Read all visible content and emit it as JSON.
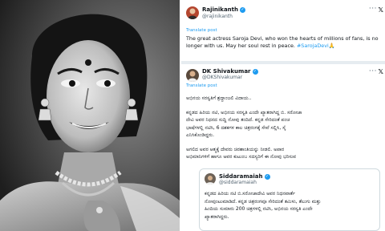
{
  "tweets": [
    {
      "name": "Rajinikanth",
      "handle": "@rajinikanth",
      "translate": "Translate post",
      "text_main": "The great actress Saroja Devi, who won the hearts of millions of fans, is no longer with us. May her soul rest in peace. ",
      "hashtag": "#SarojaDevi",
      "emoji": "🙏"
    },
    {
      "name": "DK Shivakumar",
      "handle": "@DKShivakumar",
      "translate": "Translate post",
      "lines": [
        "ಅಭಿನಯ ಸರಸ್ವತಿಗೆ ಶ್ರದ್ಧಾಂಜಲಿ ವಿದಾಯ..",
        "ಕನ್ನಡದ ಹಿರಿಯ ನಟಿ, ಅಭಿನಯ ಸರಸ್ವತಿ ಎಂದೇ ಖ್ಯಾತರಾಗಿದ್ದ ಬಿ. ಸರೋಜಾ",
        "ದೇವಿ ಅವರ ನಿಧನದ ಸುದ್ದಿ ನೋವು ತಂದಿದೆ. ಕನ್ನಡ ಸೇರಿದಂತೆ ಪಂಚ",
        "ಭಾಷೆಗಳಲ್ಲಿ ನಟಿಸಿ, 6 ದಶಕಗಳ ಕಾಲ ಚಿತ್ರರಂಗಕ್ಕೆ ಸೇವೆ ಸಲ್ಲಿಸಿ, ಸೈ",
        "ಎನಿಸಿಕೊಂಡಿದ್ದರು.",
        "ಅಗಲಿದ ಅವರ ಆತ್ಮಕ್ಕೆ ದೇವರು ಚಿರಶಾಂತಿಯನ್ನು ನೀಡಲಿ. ಅಪಾರ",
        "ಅಭಿಮಾನಿಗಳಿಗೆ ಹಾಗೂ ಅವರ ಕುಟುಂಬ ಸದಸ್ಯರಿಗೆ ಈ ನೋವು ಭರಿಸುವ"
      ]
    },
    {
      "name": "Siddaramaiah",
      "handle": "@siddaramaiah",
      "lines": [
        "ಕನ್ನಡದ ಹಿರಿಯ ನಟಿ ಬಿ.ಸರೋಜಾದೇವಿ ಅವರ ನಿಧನವಾರ್ತೆ",
        "ನೋವುಂಟುಮಾಡಿದೆ. ಕನ್ನಡ ಚಿತ್ರರಂಗವೂ ಸೇರಿದಂತೆ ತಮಿಳು, ತೆಲುಗು ಮತ್ತು",
        "ಹಿಂದಿಯ ಸುಮಾರು 200 ಚಿತ್ರಗಳಲ್ಲಿ ನಟಿಸಿ, ಅಭಿನಯ ಸರಸ್ವತಿ ಎಂದೇ",
        "ಖ್ಯಾತರಾಗಿದ್ದರು."
      ]
    }
  ],
  "ui": {
    "more_glyph": "···",
    "x_glyph": "𝕏",
    "verified_glyph": "✓"
  },
  "colors": {
    "link": "#1d9bf0",
    "text": "#0f1419",
    "muted": "#536471",
    "divider": "#e6ecf0"
  }
}
